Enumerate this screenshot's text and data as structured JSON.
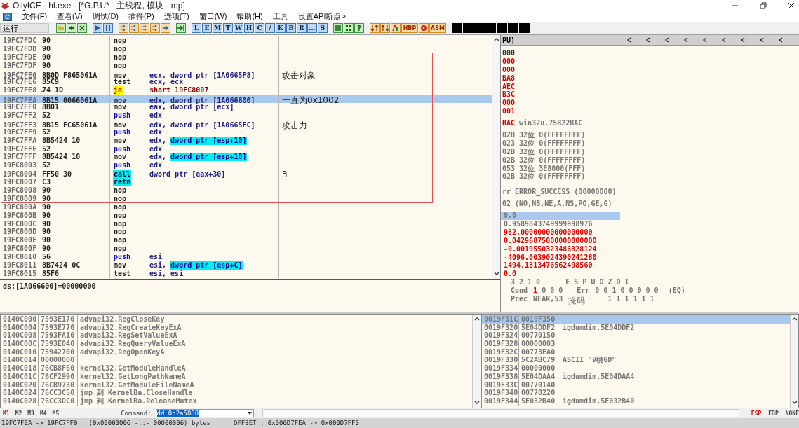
{
  "window": {
    "title": "OllyICE - hl.exe - [*G.P.U* - 主线程, 模块 - mp]"
  },
  "menu": {
    "badge": "C",
    "items": [
      "文件(F)",
      "查看(V)",
      "调试(D)",
      "插件(P)",
      "选项(T)",
      "窗口(W)",
      "帮助(H)",
      "工具",
      "设置API断点>"
    ]
  },
  "toolbar": {
    "status": "运行",
    "letters": [
      "L",
      "E",
      "M",
      "T",
      "W",
      "H",
      "C",
      "/",
      "K",
      "B",
      "R",
      "...",
      "S"
    ],
    "help": "?",
    "orange_labels": [
      "HBP",
      "ASM"
    ]
  },
  "disasm": {
    "rows": [
      {
        "address": "19FC7FDC",
        "hex": "90",
        "mnemonic": "nop",
        "kind": "plain",
        "operands": "",
        "highlight": "",
        "comment": "",
        "selected": false
      },
      {
        "address": "19FC7FDD",
        "hex": "90",
        "mnemonic": "nop",
        "kind": "plain",
        "operands": "",
        "highlight": "",
        "comment": "",
        "selected": false
      },
      {
        "address": "19FC7FDE",
        "hex": "90",
        "mnemonic": "nop",
        "kind": "plain",
        "operands": "",
        "highlight": "",
        "comment": "",
        "selected": false
      },
      {
        "address": "19FC7FDF",
        "hex": "90",
        "mnemonic": "nop",
        "kind": "plain",
        "operands": "",
        "highlight": "",
        "comment": "",
        "selected": false
      },
      {
        "address": "19FC7FE0",
        "hex": "8B0D F865061A",
        "mnemonic": "mov",
        "kind": "plain",
        "operands": "ecx, dword ptr [1A0665F8]",
        "highlight": "",
        "comment": "攻击对象",
        "selected": false
      },
      {
        "address": "19FC7FE6",
        "hex": "85C9",
        "mnemonic": "test",
        "kind": "plain",
        "operands": "ecx, ecx",
        "highlight": "",
        "comment": "",
        "selected": false
      },
      {
        "address": "19FC7FE8",
        "branch_mark": "⌄",
        "hex": "74 1D",
        "mnemonic": "je",
        "kind": "jump",
        "operands": "short 19FC8007",
        "highlight": "",
        "comment": "",
        "selected": false
      },
      {
        "address": "19FC7FEA",
        "hex": "8B15 0066061A",
        "mnemonic": "mov",
        "kind": "plain",
        "operands": "edx, dword ptr [1A066600]",
        "highlight": "",
        "comment": "一直为0x1002",
        "selected": true
      },
      {
        "address": "19FC7FF0",
        "hex": "8B01",
        "mnemonic": "mov",
        "kind": "plain",
        "operands": "eax, dword ptr [ecx]",
        "highlight": "",
        "comment": "",
        "selected": false
      },
      {
        "address": "19FC7FF2",
        "hex": "52",
        "mnemonic": "push",
        "kind": "push",
        "operands": "edx",
        "highlight": "",
        "comment": "",
        "selected": false
      },
      {
        "address": "19FC7FF3",
        "hex": "8B15 FC65061A",
        "mnemonic": "mov",
        "kind": "plain",
        "operands": "edx, dword ptr [1A0665FC]",
        "highlight": "",
        "comment": "攻击力",
        "selected": false
      },
      {
        "address": "19FC7FF9",
        "hex": "52",
        "mnemonic": "push",
        "kind": "push",
        "operands": "edx",
        "highlight": "",
        "comment": "",
        "selected": false
      },
      {
        "address": "19FC7FFA",
        "hex": "8B5424 10",
        "mnemonic": "mov",
        "kind": "plain",
        "operands": "edx,",
        "highlight": "dword ptr [esp+10]",
        "comment": "",
        "selected": false
      },
      {
        "address": "19FC7FFE",
        "hex": "52",
        "mnemonic": "push",
        "kind": "push",
        "operands": "edx",
        "highlight": "",
        "comment": "",
        "selected": false
      },
      {
        "address": "19FC7FFF",
        "hex": "8B5424 10",
        "mnemonic": "mov",
        "kind": "plain",
        "operands": "edx,",
        "highlight": "dword ptr [esp+10]",
        "comment": "",
        "selected": false
      },
      {
        "address": "19FC8003",
        "hex": "52",
        "mnemonic": "push",
        "kind": "push",
        "operands": "edx",
        "highlight": "",
        "comment": "",
        "selected": false
      },
      {
        "address": "19FC8004",
        "hex": "FF50 30",
        "mnemonic": "call",
        "kind": "call",
        "operands": "dword ptr [eax+30]",
        "highlight": "",
        "comment": "3",
        "selected": false
      },
      {
        "address": "19FC8007",
        "hex": "C3",
        "mnemonic": "retn",
        "kind": "call",
        "operands": "",
        "highlight": "",
        "comment": "",
        "selected": false
      },
      {
        "address": "19FC8008",
        "hex": "90",
        "mnemonic": "nop",
        "kind": "plain",
        "operands": "",
        "highlight": "",
        "comment": "",
        "selected": false
      },
      {
        "address": "19FC8009",
        "hex": "90",
        "mnemonic": "nop",
        "kind": "plain",
        "operands": "",
        "highlight": "",
        "comment": "",
        "selected": false
      },
      {
        "address": "19FC800A",
        "hex": "90",
        "mnemonic": "nop",
        "kind": "plain",
        "operands": "",
        "highlight": "",
        "comment": "",
        "selected": false
      },
      {
        "address": "19FC800B",
        "hex": "90",
        "mnemonic": "nop",
        "kind": "plain",
        "operands": "",
        "highlight": "",
        "comment": "",
        "selected": false
      },
      {
        "address": "19FC800C",
        "hex": "90",
        "mnemonic": "nop",
        "kind": "plain",
        "operands": "",
        "highlight": "",
        "comment": "",
        "selected": false
      },
      {
        "address": "19FC800D",
        "hex": "90",
        "mnemonic": "nop",
        "kind": "plain",
        "operands": "",
        "highlight": "",
        "comment": "",
        "selected": false
      },
      {
        "address": "19FC800E",
        "hex": "90",
        "mnemonic": "nop",
        "kind": "plain",
        "operands": "",
        "highlight": "",
        "comment": "",
        "selected": false
      },
      {
        "address": "19FC800F",
        "hex": "90",
        "mnemonic": "nop",
        "kind": "plain",
        "operands": "",
        "highlight": "",
        "comment": "",
        "selected": false
      },
      {
        "address": "19FC8010",
        "hex": "56",
        "mnemonic": "push",
        "kind": "push",
        "operands": "esi",
        "highlight": "",
        "comment": "",
        "selected": false
      },
      {
        "address": "19FC8011",
        "hex": "8B7424 0C",
        "mnemonic": "mov",
        "kind": "plain",
        "operands": "esi,",
        "highlight": "dword ptr [esp+C]",
        "comment": "",
        "selected": false
      },
      {
        "address": "19FC8015",
        "hex": "85F6",
        "mnemonic": "test",
        "kind": "plain",
        "operands": "esi, esi",
        "highlight": "",
        "comment": "",
        "selected": false
      }
    ],
    "info": "ds:[1A066600]=00000000"
  },
  "registers": {
    "header": "PU)",
    "general": [
      {
        "value": "000",
        "changed": false
      },
      {
        "value": "000",
        "changed": true
      },
      {
        "value": "000",
        "changed": true
      },
      {
        "value": "BA8",
        "changed": true
      },
      {
        "value": "AEC",
        "changed": true
      },
      {
        "value": "B3C",
        "changed": true
      },
      {
        "value": "000",
        "changed": true
      },
      {
        "value": "001",
        "changed": true
      }
    ],
    "eip": {
      "value": "BAC",
      "note": "win32u.75B22BAC",
      "changed": true
    },
    "segments": [
      {
        "value": "02B",
        "note": "32位  0(FFFFFFFF)"
      },
      {
        "value": "023",
        "note": "32位  0(FFFFFFFF)"
      },
      {
        "value": "02B",
        "note": "32位  0(FFFFFFFF)"
      },
      {
        "value": "02B",
        "note": "32位  0(FFFFFFFF)"
      },
      {
        "value": "053",
        "note": "32位  3E8000(FFF)"
      },
      {
        "value": "02B",
        "note": "32位  0(FFFFFFFF)"
      }
    ],
    "last_error": "rr ERROR_SUCCESS (00000000)",
    "eflags": "02 (NO,NB,NE,A,NS,PO,GE,G)",
    "fpu": [
      {
        "value": "0.0",
        "changed": false,
        "selected": true
      },
      {
        "value": "0.9589843749999998976",
        "changed": false,
        "selected": false
      },
      {
        "value": "982.00000000000000000",
        "changed": true,
        "selected": false
      },
      {
        "value": "0.04296875000000000000",
        "changed": true,
        "selected": false
      },
      {
        "value": "-0.0019550323486328124",
        "changed": true,
        "selected": false
      },
      {
        "value": "-4096.0039024390241280",
        "changed": true,
        "selected": false
      },
      {
        "value": "1494.1313476562498560",
        "changed": true,
        "selected": false
      },
      {
        "value": "0.0",
        "changed": true,
        "selected": false
      }
    ],
    "flags_header": "3 2 1 0      E S P U O Z D I",
    "cond_label": "Cond",
    "cond_bits": [
      {
        "text": "1",
        "changed": true
      },
      {
        "text": "0",
        "changed": false
      },
      {
        "text": "0",
        "changed": false
      },
      {
        "text": "0",
        "changed": false
      }
    ],
    "err_label": "Err",
    "err_bits": "0 0 1 0 0 0 0 0",
    "eq": "(EQ)",
    "prec_label": "Prec",
    "prec": "NEAR,53",
    "mask_label": "掩码",
    "mask_bits": "1 1 1 1 1 1"
  },
  "dump": {
    "rows": [
      {
        "address": "0140C000",
        "value": "7593E170",
        "comment": "advapi32.RegCloseKey"
      },
      {
        "address": "0140C004",
        "value": "7593E770",
        "comment": "advapi32.RegCreateKeyExA"
      },
      {
        "address": "0140C008",
        "value": "7593FA10",
        "comment": "advapi32.RegSetValueExA"
      },
      {
        "address": "0140C00C",
        "value": "7593E040",
        "comment": "advapi32.RegQueryValueExA"
      },
      {
        "address": "0140C010",
        "value": "75942700",
        "comment": "advapi32.RegOpenKeyA"
      },
      {
        "address": "0140C014",
        "value": "00000000",
        "comment": ""
      },
      {
        "address": "0140C018",
        "value": "76CB8F60",
        "comment": "kernel32.GetModuleHandleA"
      },
      {
        "address": "0140C01C",
        "value": "76CF2990",
        "comment": "kernel32.GetLongPathNameA"
      },
      {
        "address": "0140C020",
        "value": "76CB9730",
        "comment": "kernel32.GetModuleFileNameA"
      },
      {
        "address": "0140C024",
        "value": "76CC3C50",
        "comment": "jmp 到 KernelBa.CloseHandle"
      },
      {
        "address": "0140C028",
        "value": "76CC3DC0",
        "comment": "jmp 到 KernelBa.ReleaseMutex"
      }
    ]
  },
  "stack": {
    "rows": [
      {
        "address": "0019F31C",
        "value": "0019F350",
        "comment": "",
        "selected": true
      },
      {
        "address": "0019F320",
        "value": "5E04DDF2",
        "comment": "igdumdim.5E04DDF2",
        "selected": false
      },
      {
        "address": "0019F324",
        "value": "00770150",
        "comment": "",
        "selected": false
      },
      {
        "address": "0019F328",
        "value": "00000003",
        "comment": "",
        "selected": false
      },
      {
        "address": "0019F32C",
        "value": "00773EA0",
        "comment": "",
        "selected": false
      },
      {
        "address": "0019F330",
        "value": "5C2ABC79",
        "comment": "ASCII \"V桃GD\"",
        "selected": false
      },
      {
        "address": "0019F334",
        "value": "00000000",
        "comment": "",
        "selected": false
      },
      {
        "address": "0019F338",
        "value": "5E04DAA4",
        "comment": "igdumdim.5E04DAA4",
        "selected": false
      },
      {
        "address": "0019F33C",
        "value": "00770140",
        "comment": "",
        "selected": false
      },
      {
        "address": "0019F340",
        "value": "00770220",
        "comment": "",
        "selected": false
      },
      {
        "address": "0019F344",
        "value": "5E032B40",
        "comment": "igdumdim.5E032B40",
        "selected": false
      }
    ]
  },
  "command_bar": {
    "tabs": [
      {
        "label": "M1",
        "selected": true
      },
      {
        "label": "M2",
        "selected": false
      },
      {
        "label": "M3",
        "selected": false
      },
      {
        "label": "M4",
        "selected": false
      },
      {
        "label": "M5",
        "selected": false
      }
    ],
    "label": "Command:",
    "value": "dd 0c2a5080",
    "stack_modes": [
      {
        "label": "ESP",
        "selected": true
      },
      {
        "label": "EBP",
        "selected": false
      },
      {
        "label": "NONE",
        "selected": false
      }
    ]
  },
  "status_bar": {
    "range": "19FC7FEA -> 19FC7FF0 : (0x00000006 -::- 00000006) bytes",
    "offset": "OFFSET : 0x000D7FEA -> 0x000D7FF0"
  }
}
